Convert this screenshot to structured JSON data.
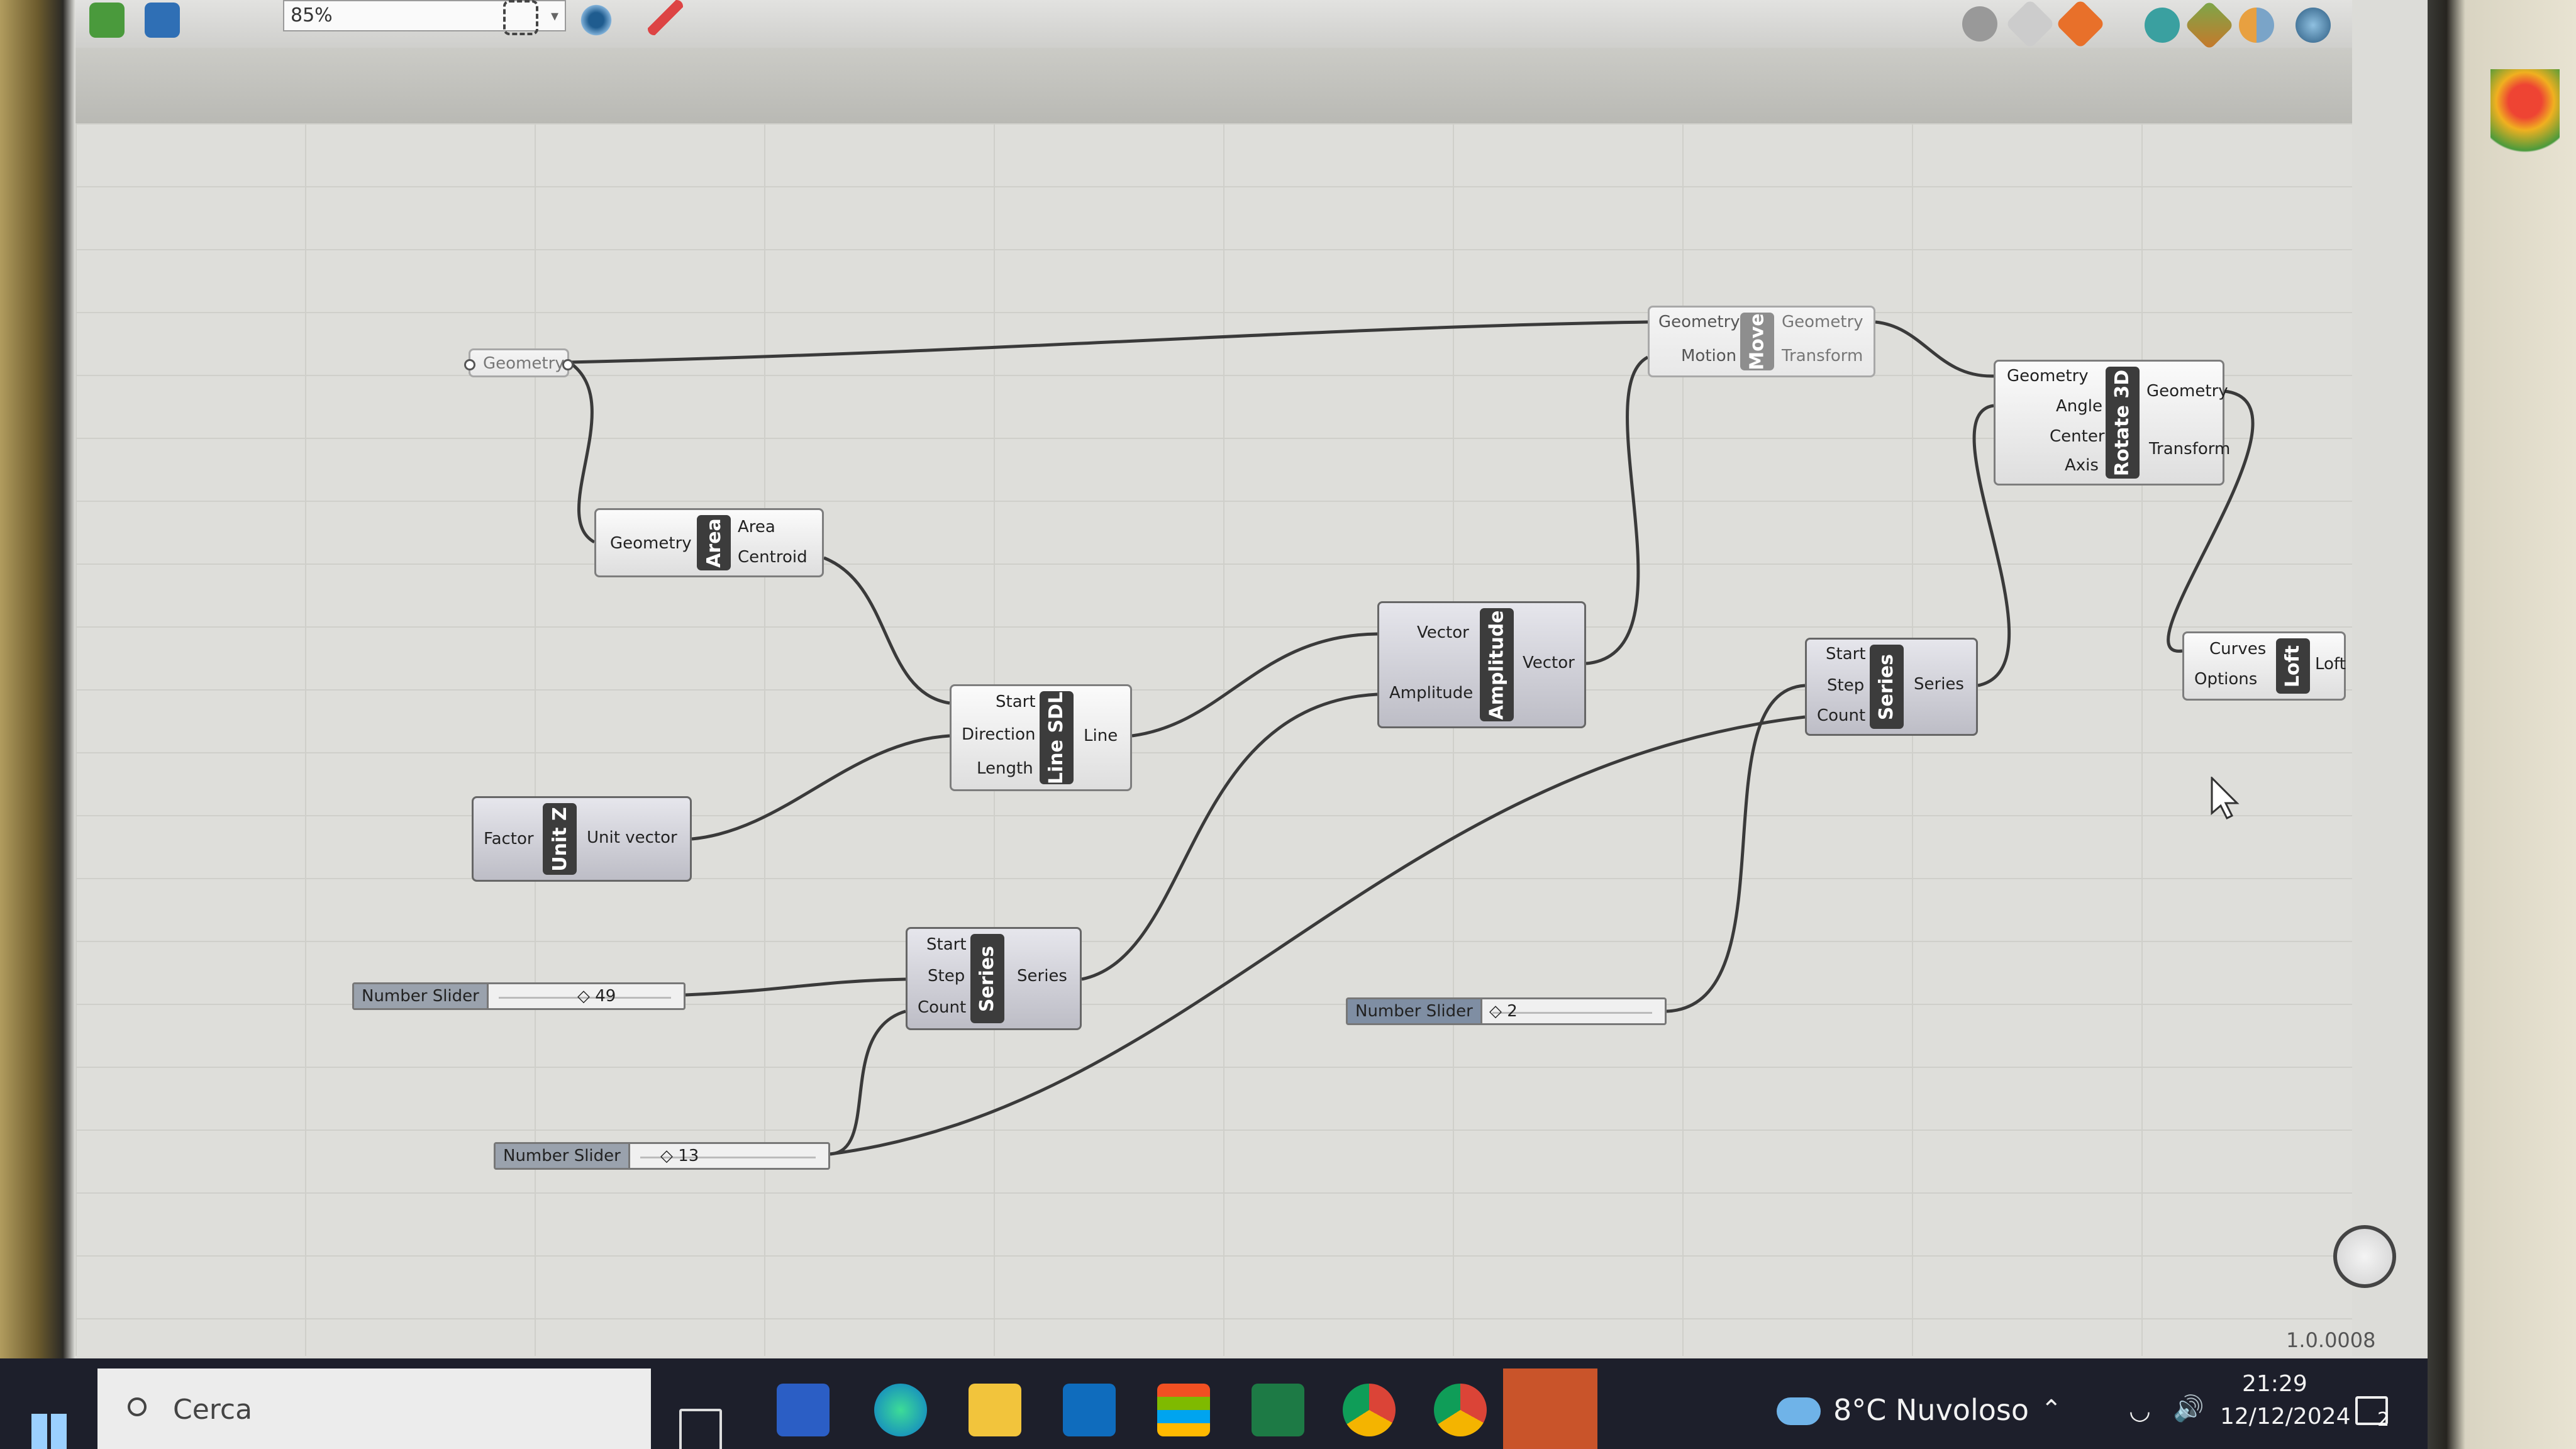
{
  "toolbar": {
    "zoom_value": "85%"
  },
  "nodes": {
    "geometry_param": {
      "label": "Geometry"
    },
    "area": {
      "name": "Area",
      "inputs": [
        "Geometry"
      ],
      "outputs": [
        "Area",
        "Centroid"
      ]
    },
    "line_sdl": {
      "name": "Line SDL",
      "inputs": [
        "Start",
        "Direction",
        "Length"
      ],
      "outputs": [
        "Line"
      ]
    },
    "unit_z": {
      "name": "Unit Z",
      "inputs": [
        "Factor"
      ],
      "outputs": [
        "Unit vector"
      ]
    },
    "series1": {
      "name": "Series",
      "inputs": [
        "Start",
        "Step",
        "Count"
      ],
      "outputs": [
        "Series"
      ]
    },
    "amplitude": {
      "name": "Amplitude",
      "inputs": [
        "Vector",
        "Amplitude"
      ],
      "outputs": [
        "Vector"
      ]
    },
    "move": {
      "name": "Move",
      "inputs": [
        "Geometry",
        "Motion"
      ],
      "outputs": [
        "Geometry",
        "Transform"
      ]
    },
    "rotate3d": {
      "name": "Rotate 3D",
      "inputs": [
        "Geometry",
        "Angle",
        "Center",
        "Axis"
      ],
      "outputs": [
        "Geometry",
        "Transform"
      ]
    },
    "series2": {
      "name": "Series",
      "inputs": [
        "Start",
        "Step",
        "Count"
      ],
      "outputs": [
        "Series"
      ]
    },
    "loft": {
      "name": "Loft",
      "inputs": [
        "Curves",
        "Options"
      ],
      "outputs": [
        "Loft"
      ]
    }
  },
  "sliders": {
    "slider1": {
      "label": "Number Slider",
      "value": "◇ 49"
    },
    "slider2": {
      "label": "Number Slider",
      "value": "◇ 13"
    },
    "slider3": {
      "label": "Number Slider",
      "value": "◇ 2"
    }
  },
  "status": {
    "version": "1.0.0008"
  },
  "taskbar": {
    "search_placeholder": "Cerca",
    "apps": [
      "task-view-icon",
      "word-icon",
      "edge-icon",
      "file-explorer-icon",
      "outlook-icon",
      "store-icon",
      "excel-icon",
      "chrome-icon",
      "chrome-profile-icon",
      "rhino-icon"
    ],
    "weather": "8°C  Nuvoloso",
    "time": "21:29",
    "date": "12/12/2024",
    "notification_count": "2"
  },
  "colors": {
    "accent_orange": "#e8702a",
    "taskbar_bg": "#1d1f2b",
    "node_core": "#3c3c3c"
  }
}
